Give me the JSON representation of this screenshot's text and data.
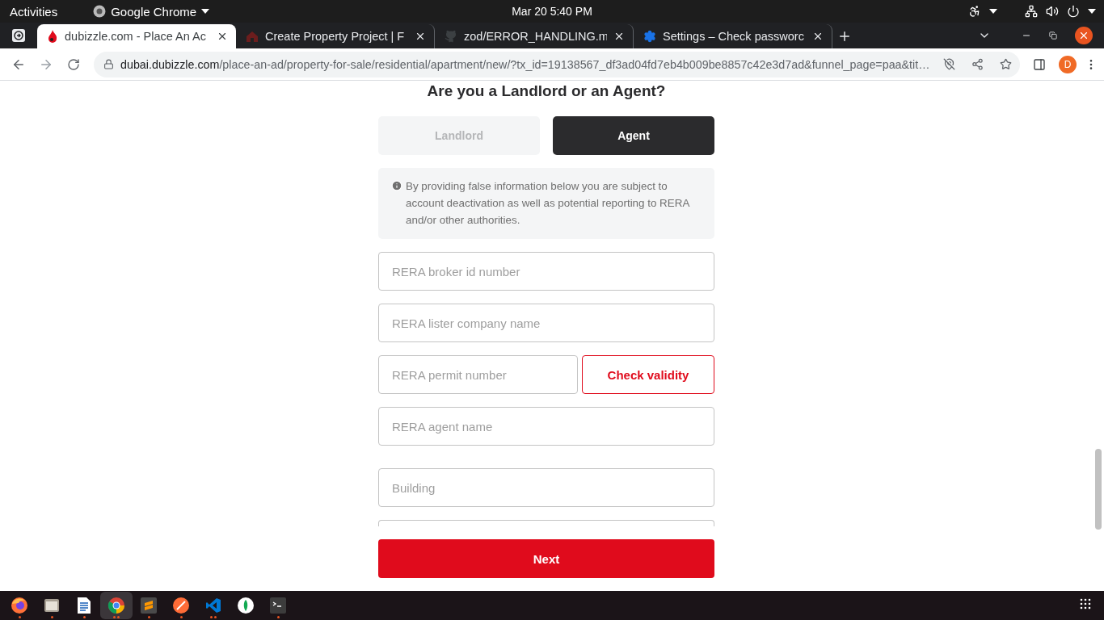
{
  "system_bar": {
    "activities": "Activities",
    "app_name": "Google Chrome",
    "clock": "Mar 20  5:40 PM"
  },
  "tabs": [
    {
      "kind": "dubizzle",
      "title": "dubizzle.com - Place An Ac",
      "selected": true
    },
    {
      "kind": "project",
      "title": "Create Property Project | F",
      "selected": false
    },
    {
      "kind": "github",
      "title": "zod/ERROR_HANDLING.m",
      "selected": false
    },
    {
      "kind": "settings",
      "title": "Settings – Check passworc",
      "selected": false
    }
  ],
  "address_bar": {
    "host": "dubai.dubizzle.com",
    "path": "/place-an-ad/property-for-sale/residential/apartment/new/?tx_id=19138567_df3ad04fd7eb4b009be8857c42e3d7ad&funnel_page=paa&tit…"
  },
  "profile": {
    "initial": "D"
  },
  "form": {
    "title": "Are you a Landlord or an Agent?",
    "roles": [
      {
        "label": "Landlord",
        "selected": false
      },
      {
        "label": "Agent",
        "selected": true
      }
    ],
    "notice": "By providing false information below you are subject to account deactivation as well as potential reporting to RERA and/or other authorities.",
    "agent_fields": [
      {
        "placeholder": "RERA broker id number"
      },
      {
        "placeholder": "RERA lister company name"
      },
      {
        "placeholder": "RERA permit number",
        "action": "Check validity"
      },
      {
        "placeholder": "RERA agent name"
      }
    ],
    "property_fields": [
      {
        "placeholder": "Building"
      }
    ],
    "next": "Next"
  },
  "taskbar": [
    {
      "kind": "firefox",
      "open": true,
      "multiple": false,
      "selected": false
    },
    {
      "kind": "files",
      "open": true,
      "multiple": false,
      "selected": false
    },
    {
      "kind": "writer",
      "open": true,
      "multiple": false,
      "selected": false
    },
    {
      "kind": "chrome",
      "open": true,
      "multiple": true,
      "selected": true
    },
    {
      "kind": "sublime",
      "open": true,
      "multiple": false,
      "selected": false
    },
    {
      "kind": "postman",
      "open": true,
      "multiple": false,
      "selected": false
    },
    {
      "kind": "vscode",
      "open": true,
      "multiple": true,
      "selected": false
    },
    {
      "kind": "compass",
      "open": false,
      "selected": false
    },
    {
      "kind": "terminal",
      "open": true,
      "multiple": false,
      "selected": false
    }
  ]
}
